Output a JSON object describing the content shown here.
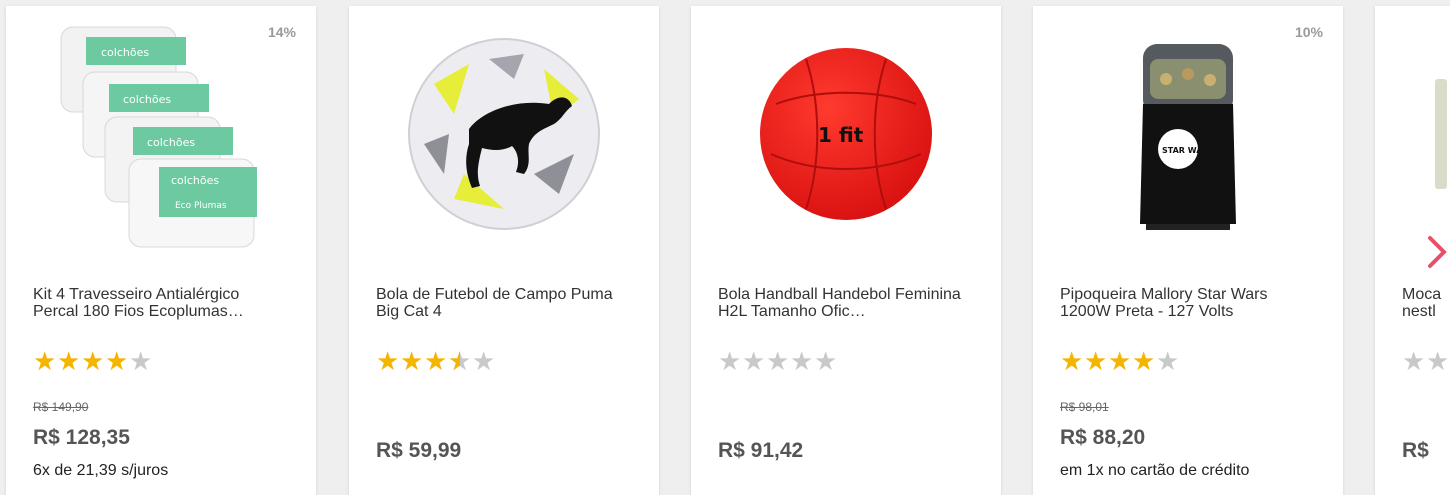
{
  "products": [
    {
      "discount": "14%",
      "image": "pillows-image",
      "title": "Kit 4 Travesseiro Antialérgico Percal 180 Fios Ecoplumas…",
      "rating": 4,
      "old_price": "R$ 149,90",
      "price": "R$ 128,35",
      "installments": "6x de 21,39 s/juros",
      "image_text": {
        "brand": "colchões",
        "product": "Eco Plumas"
      }
    },
    {
      "discount": "",
      "image": "soccer-ball-image",
      "title": "Bola de Futebol de Campo Puma Big Cat 4",
      "rating": 3.5,
      "old_price": "",
      "price": "R$ 59,99",
      "installments": ""
    },
    {
      "discount": "",
      "image": "handball-image",
      "title": "Bola Handball Handebol Feminina H2L Tamanho Ofic…",
      "rating": 0,
      "old_price": "",
      "price": "R$ 91,42",
      "installments": "",
      "image_text": {
        "brand": "1 fit"
      }
    },
    {
      "discount": "10%",
      "image": "popcorn-maker-image",
      "title": "Pipoqueira Mallory Star Wars 1200W Preta - 127 Volts",
      "rating": 4,
      "old_price": "R$ 98,01",
      "price": "R$ 88,20",
      "installments": "em 1x no cartão de crédito",
      "image_text": {
        "logo": "STAR WARS"
      }
    },
    {
      "discount": "",
      "image": "partial-product-image",
      "title": "Moca nestl",
      "rating": 0,
      "old_price": "",
      "price": "R$",
      "installments": ""
    }
  ],
  "icons": {
    "next": "chevron-right-icon",
    "star": "star-icon"
  },
  "colors": {
    "star_filled": "#f4b400",
    "star_empty": "#c9c9c9",
    "price": "#555555",
    "next_arrow": "#e8506a"
  }
}
